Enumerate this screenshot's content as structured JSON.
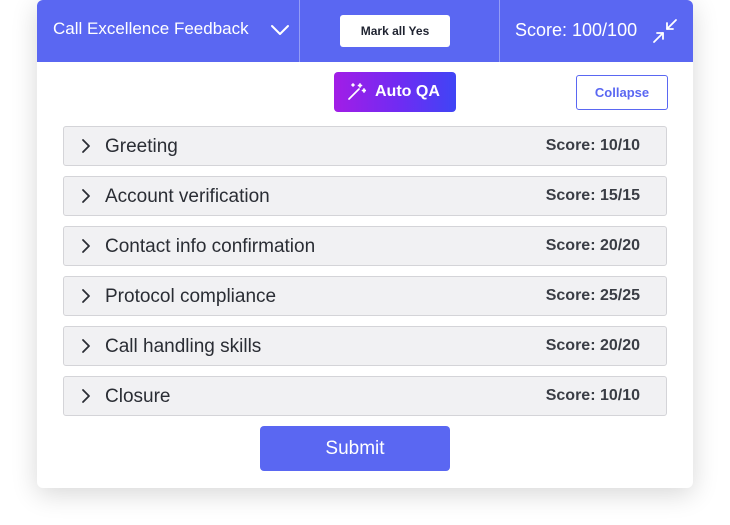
{
  "header": {
    "form_title": "Call Excellence Feedback",
    "dropdown_icon": "chevron-down-icon",
    "mark_all_label": "Mark all Yes",
    "total_score": "Score: 100/100",
    "collapse_icon": "minimize-arrows-icon"
  },
  "toolbar": {
    "auto_qa_label": "Auto QA",
    "auto_qa_icon": "magic-wand-icon",
    "collapse_label": "Collapse"
  },
  "sections": [
    {
      "name": "Greeting",
      "score": "Score: 10/10"
    },
    {
      "name": "Account verification",
      "score": "Score: 15/15"
    },
    {
      "name": "Contact info confirmation",
      "score": "Score: 20/20"
    },
    {
      "name": "Protocol compliance",
      "score": "Score: 25/25"
    },
    {
      "name": "Call handling skills",
      "score": "Score: 20/20"
    },
    {
      "name": "Closure",
      "score": "Score: 10/10"
    }
  ],
  "footer": {
    "submit_label": "Submit"
  },
  "colors": {
    "primary": "#5a67f2",
    "auto_qa_gradient_start": "#a21de6",
    "auto_qa_gradient_end": "#3f45f5",
    "section_bg": "#f1f1f3"
  }
}
